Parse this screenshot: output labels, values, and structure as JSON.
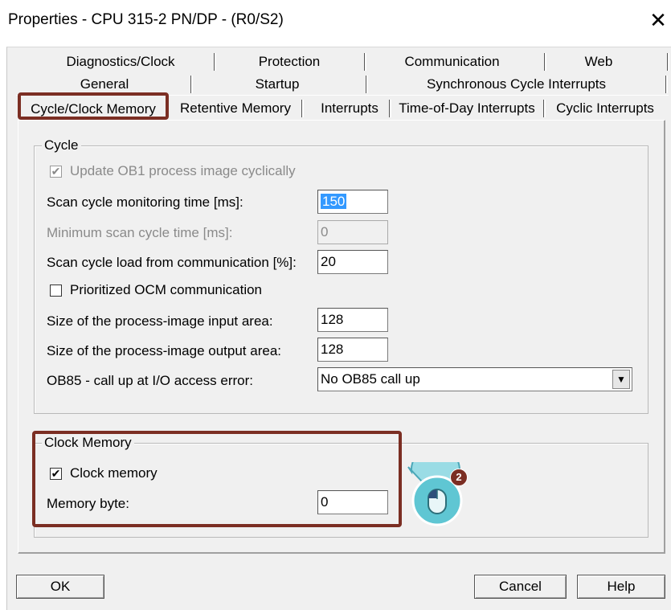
{
  "window": {
    "title": "Properties - CPU 315-2 PN/DP - (R0/S2)",
    "close_glyph": "✕"
  },
  "tabs": {
    "row1": [
      "Diagnostics/Clock",
      "Protection",
      "Communication",
      "Web"
    ],
    "row2": [
      "General",
      "Startup",
      "Synchronous Cycle Interrupts"
    ],
    "row3": [
      "Cycle/Clock Memory",
      "Retentive Memory",
      "Interrupts",
      "Time-of-Day Interrupts",
      "Cyclic Interrupts"
    ]
  },
  "cycle": {
    "group_label": "Cycle",
    "update_ob1": {
      "label": "Update OB1 process image cyclically",
      "checked": true,
      "enabled": false
    },
    "scan_monitoring": {
      "label": "Scan cycle monitoring time [ms]:",
      "value": "150"
    },
    "min_scan": {
      "label": "Minimum scan cycle time [ms]:",
      "value": "0"
    },
    "scan_load": {
      "label": "Scan cycle load from communication [%]:",
      "value": "20"
    },
    "prioritized_ocm": {
      "label": "Prioritized OCM communication",
      "checked": false
    },
    "pi_input": {
      "label": "Size of the process-image input area:",
      "value": "128"
    },
    "pi_output": {
      "label": "Size of the process-image output area:",
      "value": "128"
    },
    "ob85": {
      "label": "OB85 - call up at I/O access error:",
      "value": "No OB85 call up"
    }
  },
  "clock_memory": {
    "group_label": "Clock Memory",
    "clock_memory_cb": {
      "label": "Clock memory",
      "checked": true
    },
    "memory_byte": {
      "label": "Memory byte:",
      "value": "0"
    }
  },
  "callout": {
    "number": "2"
  },
  "buttons": {
    "ok": "OK",
    "cancel": "Cancel",
    "help": "Help"
  },
  "colors": {
    "highlight": "#7b2e23",
    "selection": "#3399ff",
    "callout": "#5fc6d3",
    "dialog_bg": "#f0f0f0"
  }
}
